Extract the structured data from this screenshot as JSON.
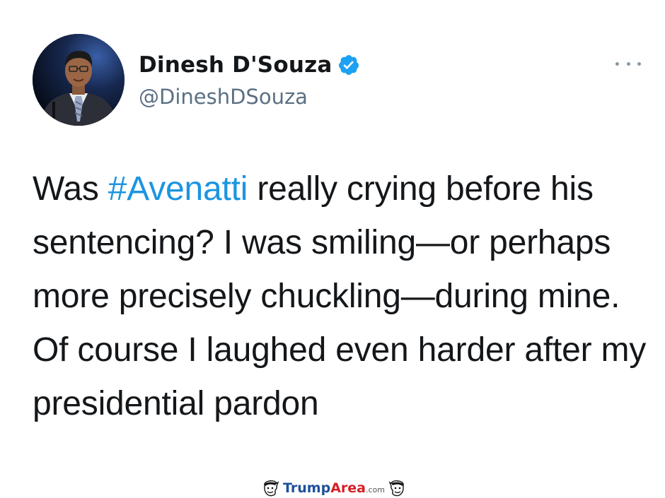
{
  "tweet": {
    "author": {
      "display_name": "Dinesh D'Souza",
      "handle": "@DineshDSouza",
      "verified": true
    },
    "text": {
      "prefix": "Was ",
      "hashtag": "#Avenatti",
      "suffix": " really crying before his sentencing? I was smiling—or perhaps more precisely chuckling—during mine. Of course I laughed even harder after my presidential pardon"
    },
    "more_menu": {
      "icon": "more-dots-icon"
    }
  },
  "watermark": {
    "brand_part1": "Trump",
    "brand_part2": "Area",
    "tld": ".com"
  },
  "colors": {
    "background": "#ffffff",
    "text_primary": "#14171a",
    "text_secondary": "#5b7083",
    "link_blue": "#1b95e0",
    "verified_blue": "#1da1f2",
    "watermark_blue": "#1d4f9c",
    "watermark_red": "#d61f26"
  }
}
